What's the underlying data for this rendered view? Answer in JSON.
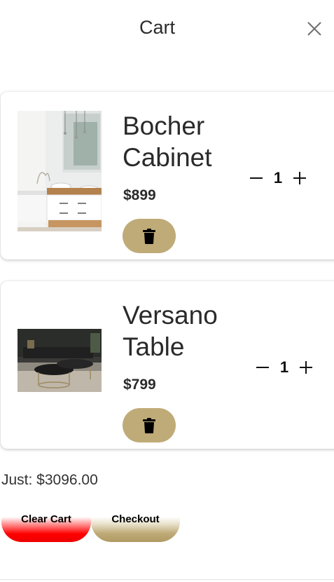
{
  "header": {
    "title": "Cart",
    "close_icon": "close-icon"
  },
  "items": [
    {
      "name": "Bocher Cabinet",
      "price": "$899",
      "quantity": "1",
      "image": "bathroom-vanity-cabinet-photo",
      "delete_icon": "trash-icon"
    },
    {
      "name": "Versano Table",
      "price": "$799",
      "quantity": "1",
      "image": "round-coffee-table-photo",
      "delete_icon": "trash-icon"
    }
  ],
  "summary": {
    "total": "Just: $3096.00"
  },
  "actions": {
    "clear_label": "Clear Cart",
    "checkout_label": "Checkout"
  },
  "colors": {
    "accent": "#bfab78",
    "danger": "#ff0000"
  }
}
